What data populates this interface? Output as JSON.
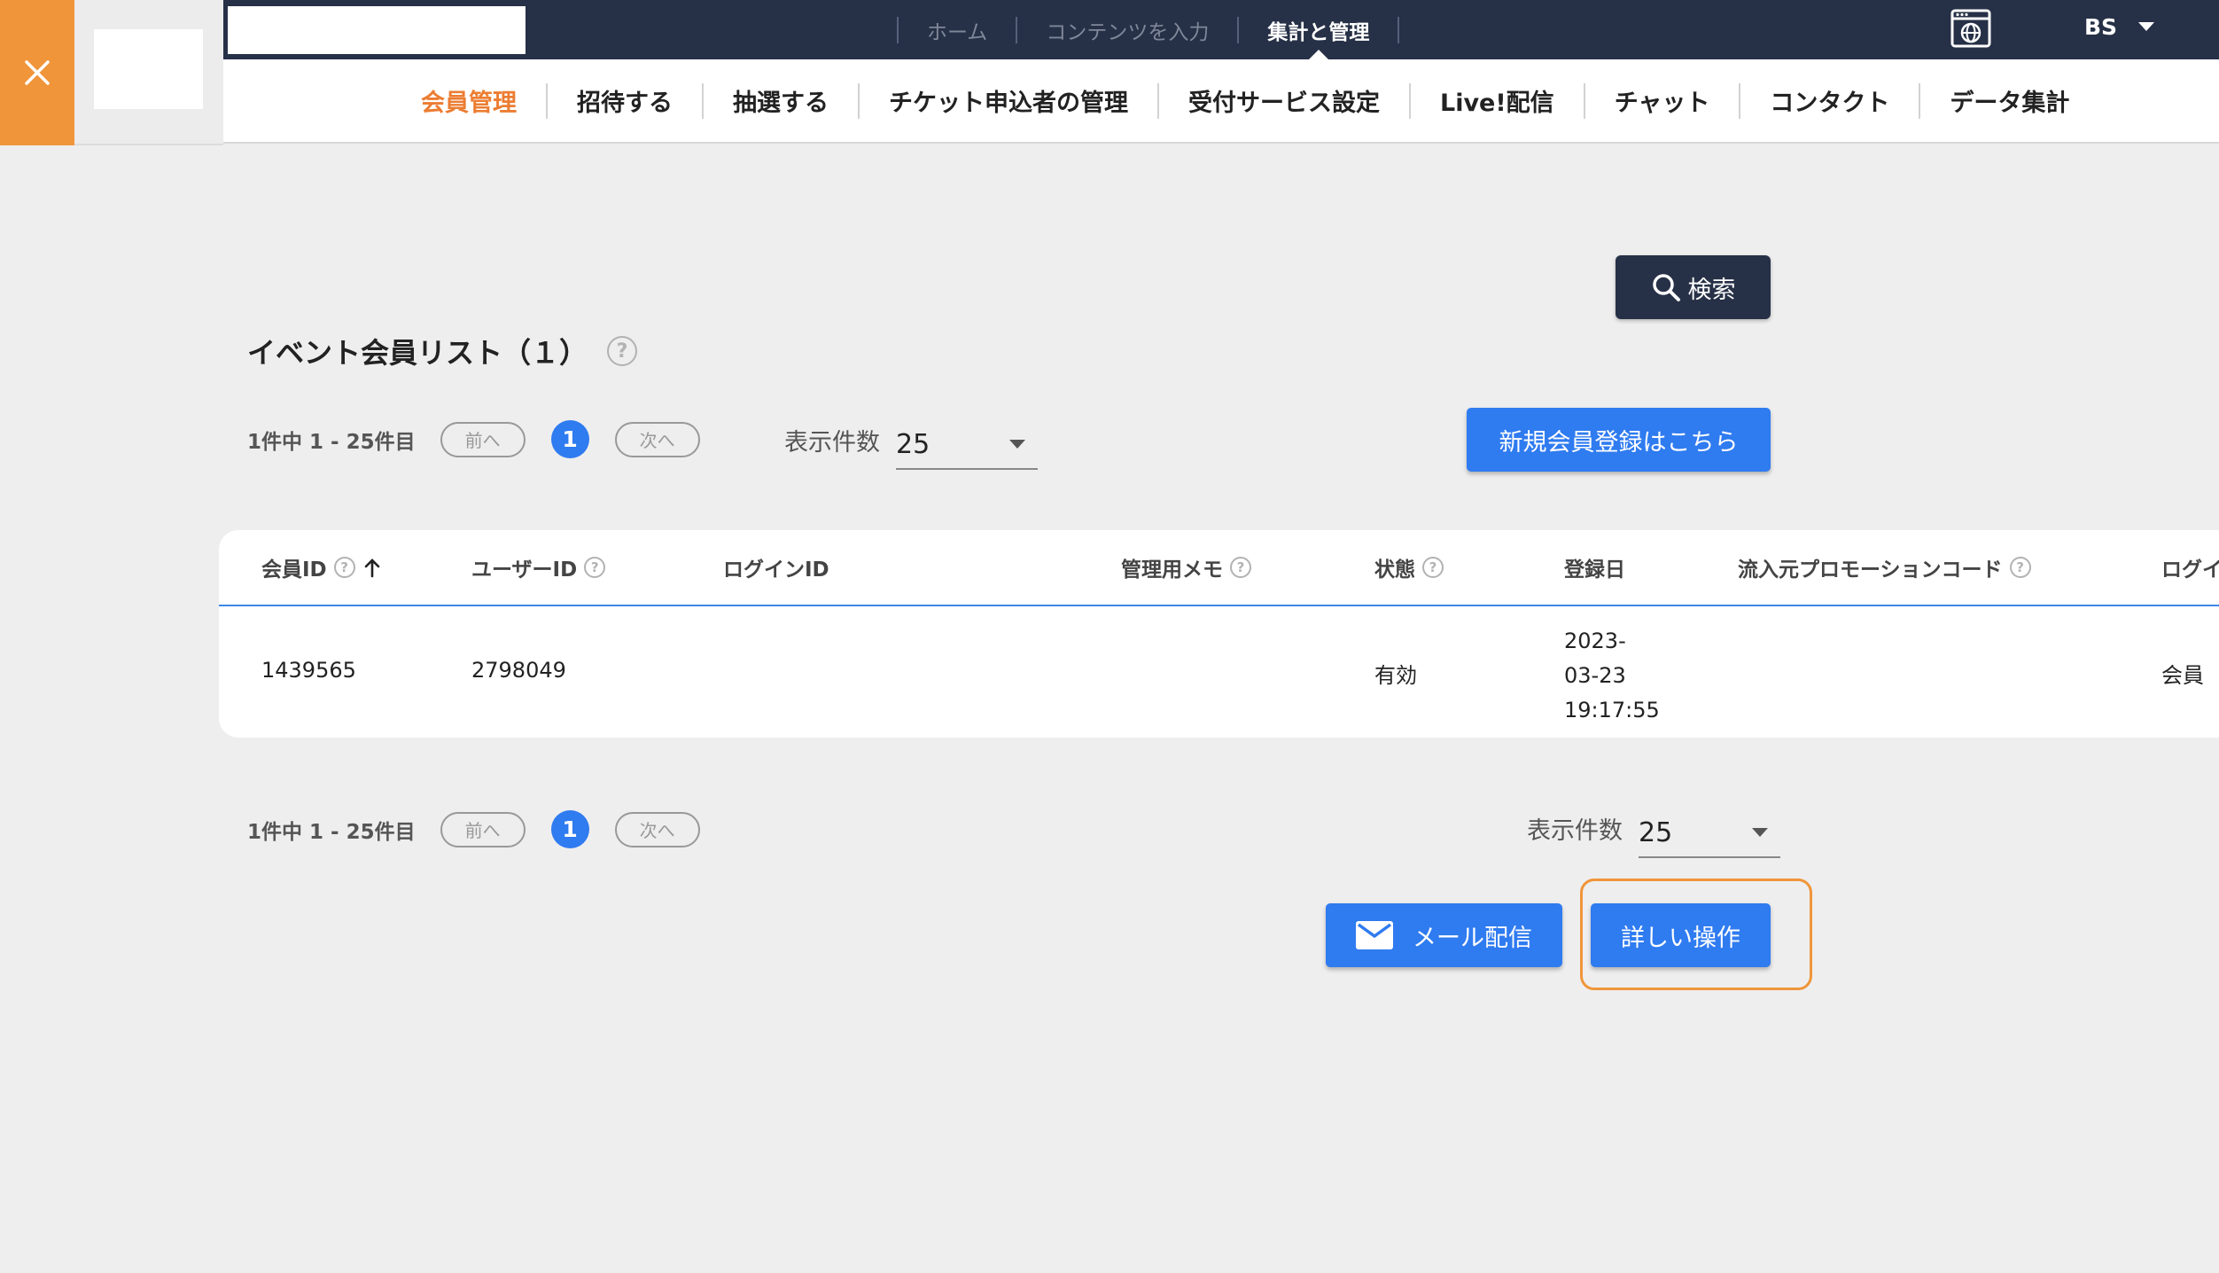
{
  "top_bar": {
    "search_value": "",
    "nav": [
      {
        "label": "ホーム",
        "active": false
      },
      {
        "label": "コンテンツを入力",
        "active": false
      },
      {
        "label": "集計と管理",
        "active": true
      }
    ],
    "globe_icon": "browser-globe-icon",
    "user_initials": "BS"
  },
  "sub_nav": {
    "tabs": [
      {
        "label": "会員管理",
        "active": true
      },
      {
        "label": "招待する"
      },
      {
        "label": "抽選する"
      },
      {
        "label": "チケット申込者の管理"
      },
      {
        "label": "受付サービス設定"
      },
      {
        "label": "Live!配信"
      },
      {
        "label": "チャット"
      },
      {
        "label": "コンタクト"
      },
      {
        "label": "データ集計"
      }
    ]
  },
  "search_button": {
    "label": "検索",
    "icon": "search-icon"
  },
  "list": {
    "title": "イベント会員リスト（１）",
    "help": "?"
  },
  "register_button": {
    "label": "新規会員登録はこちら"
  },
  "pagination_top": {
    "count_text": "1件中 1 - 25件目",
    "prev": "前へ",
    "current": "1",
    "next": "次へ",
    "per_page_label": "表示件数",
    "per_page_value": "25"
  },
  "table": {
    "columns": [
      {
        "label": "会員ID",
        "help": true,
        "sort": "asc"
      },
      {
        "label": "ユーザーID",
        "help": true
      },
      {
        "label": "ログインID"
      },
      {
        "label": "管理用メモ",
        "help": true
      },
      {
        "label": "状態",
        "help": true
      },
      {
        "label": "登録日"
      },
      {
        "label": "流入元プロモーションコード",
        "help": true
      },
      {
        "label": "ログイ"
      }
    ],
    "rows": [
      {
        "member_id": "1439565",
        "user_id": "2798049",
        "login_id": "",
        "memo": "",
        "status": "有効",
        "reg_date_line1": "2023-",
        "reg_date_line2": "03-23",
        "reg_date_line3": "19:17:55",
        "promo": "",
        "login": "会員"
      }
    ]
  },
  "pagination_bottom": {
    "count_text": "1件中 1 - 25件目",
    "prev": "前へ",
    "current": "1",
    "next": "次へ",
    "per_page_label": "表示件数",
    "per_page_value": "25"
  },
  "actions": {
    "mail_label": "メール配信",
    "mail_icon": "mail-icon",
    "detail_label": "詳しい操作"
  },
  "colors": {
    "accent_orange": "#f0953a",
    "primary_blue": "#2f7bf0",
    "topbar_navy": "#263046",
    "active_tab": "#ec7d32"
  }
}
